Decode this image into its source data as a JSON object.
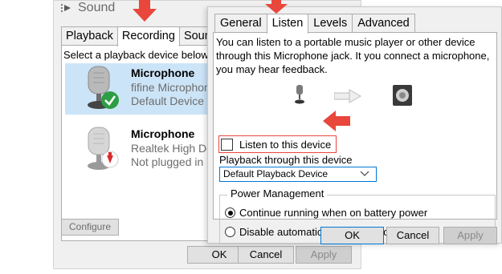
{
  "sound_dialog": {
    "title": "Sound",
    "tabs": [
      {
        "label": "Playback"
      },
      {
        "label": "Recording"
      },
      {
        "label": "Sound"
      }
    ],
    "hint": "Select a playback device below to",
    "devices": [
      {
        "name": "Microphone",
        "line1": "fifine Microphon",
        "line2": "Default Device",
        "status": "default"
      },
      {
        "name": "Microphone",
        "line1": "Realtek High De",
        "line2": "Not plugged in",
        "status": "unplugged"
      }
    ],
    "configure_label": "Configure",
    "buttons": {
      "ok": "OK",
      "cancel": "Cancel",
      "apply": "Apply"
    }
  },
  "props_dialog": {
    "tabs": [
      {
        "label": "General"
      },
      {
        "label": "Listen"
      },
      {
        "label": "Levels"
      },
      {
        "label": "Advanced"
      }
    ],
    "description": "You can listen to a portable music player or other device through this Microphone jack. It you connect a microphone, you may hear feedback.",
    "listen_checkbox_label": "Listen to this device",
    "listen_checked": false,
    "playback_label": "Playback through this device",
    "playback_value": "Default Playback Device",
    "power_group_label": "Power Management",
    "radio_options": [
      {
        "label": "Continue running when on battery power",
        "checked": true
      },
      {
        "label": "Disable automatically to save power",
        "checked": false
      }
    ],
    "buttons": {
      "ok": "OK",
      "cancel": "Cancel",
      "apply": "Apply"
    }
  },
  "colors": {
    "accent": "#0078d7",
    "annotation": "#e9463c",
    "selected_row": "#cce4f7",
    "dialog_bg": "#f0f0f0"
  }
}
